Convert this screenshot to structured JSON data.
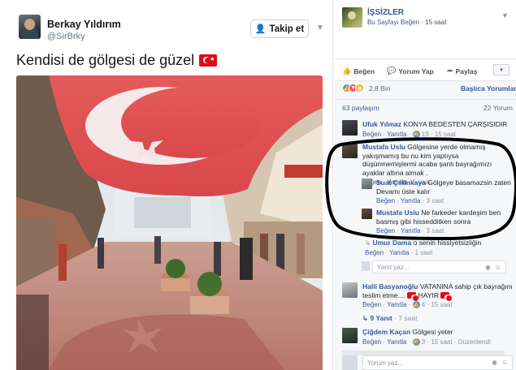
{
  "tweet": {
    "author_name": "Berkay Yıldırım",
    "author_handle": "@SirBrky",
    "follow_label": "Takip et",
    "text": "Kendisi de gölgesi de güzel"
  },
  "facebook": {
    "page_name": "İŞSİZLER",
    "page_meta_link": "Bu Sayfayı Beğen",
    "page_meta_time": "15 saat",
    "actions": {
      "like": "Beğen",
      "comment": "Yorum Yap",
      "share": "Paylaş"
    },
    "reaction_count": "2,8 Bin",
    "sort_label": "Başlıca Yorumlar",
    "shares": "63 paylaşım",
    "comment_count": "22 Yorum",
    "comments": [
      {
        "name": "Ufuk Yılmaz",
        "text": "KONYA BEDESTEN ÇARŞISIDIR",
        "like": "Beğen",
        "reply": "Yanıtla",
        "likes": "19",
        "time": "15 saat"
      },
      {
        "name": "Mustafa Uslu",
        "text": "Gölgesine yerde olmamış yakışmamış bu nu kim yaptıysa düşünmemişlermi acaba şanlı bayrağımızı ayaklar altına almak .",
        "like": "Beğen",
        "reply": "Yanıtla",
        "time": "5 saat"
      },
      {
        "name": "Suat Çetinkaya",
        "text": "Gölgeye basamazsin zaten Devamı üste kalır",
        "like": "Beğen",
        "reply": "Yanıtla",
        "time": "3 saat"
      },
      {
        "name": "Mustafa Uslu",
        "text": "Ne farkeder kardeşim ben basmış gibi hissedditken sonra",
        "like": "Beğen",
        "reply": "Yanıtla",
        "time": "3 saat"
      },
      {
        "name": "Umur Dama",
        "text": "o senin hissiyetsizliğin",
        "like": "Beğen",
        "reply": "Yanıtla",
        "time": "1 saat"
      },
      {
        "name": "Halil Basyanoğlu",
        "text": "VATANINA sahip çık bayrağını teslim etme....",
        "text_tail": "HAYIR",
        "like": "Beğen",
        "reply": "Yanıtla",
        "likes": "4",
        "time": "15 saat"
      },
      {
        "name": "Çiğdem Kaçan",
        "text": "Gölgesi yeter",
        "like": "Beğen",
        "reply": "Yanıtla",
        "likes": "3",
        "time": "15 saat",
        "edited": "Düzenlendi"
      }
    ],
    "reply_placeholder": "Yanıt yaz...",
    "nine_replies": "9 Yanıt",
    "nine_replies_time": "7 saat",
    "comment_placeholder": "Yorum yaz..."
  }
}
